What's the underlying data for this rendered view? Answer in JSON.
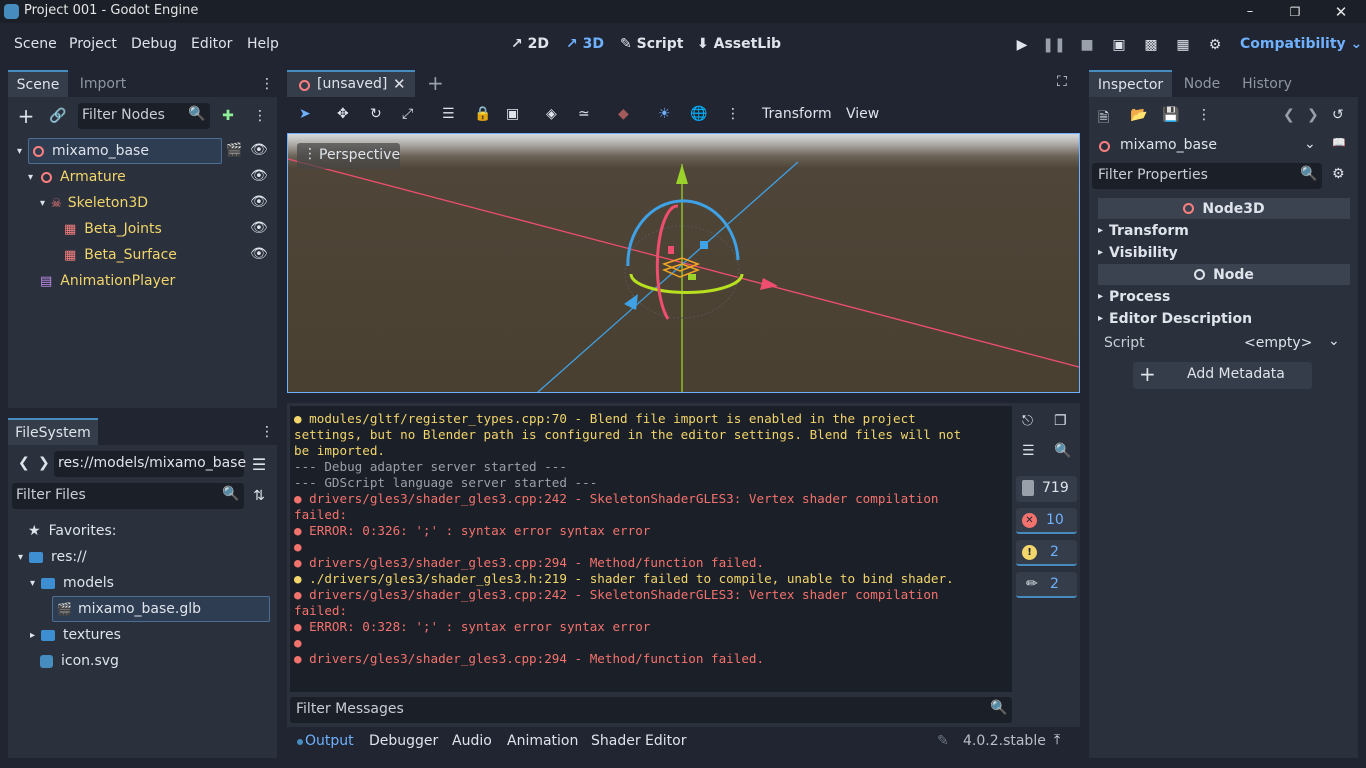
{
  "window": {
    "title": "Project 001 - Godot Engine"
  },
  "menus": [
    "Scene",
    "Project",
    "Debug",
    "Editor",
    "Help"
  ],
  "workspaces": {
    "2d": "2D",
    "3d": "3D",
    "script": "Script",
    "assetlib": "AssetLib"
  },
  "renderer": "Compatibility",
  "scene_dock": {
    "tab_scene": "Scene",
    "tab_import": "Import",
    "filter_placeholder": "Filter Nodes",
    "nodes": [
      {
        "label": "mixamo_base"
      },
      {
        "label": "Armature"
      },
      {
        "label": "Skeleton3D"
      },
      {
        "label": "Beta_Joints"
      },
      {
        "label": "Beta_Surface"
      },
      {
        "label": "AnimationPlayer"
      }
    ]
  },
  "filesystem": {
    "tab": "FileSystem",
    "path": "res://models/mixamo_base",
    "filter_placeholder": "Filter Files",
    "favorites": "Favorites:",
    "root": "res://",
    "models": "models",
    "file": "mixamo_base.glb",
    "textures": "textures",
    "icon": "icon.svg"
  },
  "viewport": {
    "tab": "[unsaved]",
    "transform": "Transform",
    "view": "View",
    "perspective": "Perspective"
  },
  "output": {
    "lines": [
      {
        "c": "y",
        "dot": true,
        "t": "modules/gltf/register_types.cpp:70 - Blend file import is enabled in the project"
      },
      {
        "c": "y",
        "dot": false,
        "t": "settings, but no Blender path is configured in the editor settings. Blend files will not"
      },
      {
        "c": "y",
        "dot": false,
        "t": "be imported."
      },
      {
        "c": "g",
        "dot": false,
        "t": "--- Debug adapter server started ---"
      },
      {
        "c": "g",
        "dot": false,
        "t": "--- GDScript language server started ---"
      },
      {
        "c": "r",
        "dot": true,
        "t": "drivers/gles3/shader_gles3.cpp:242 - SkeletonShaderGLES3: Vertex shader compilation"
      },
      {
        "c": "r",
        "dot": false,
        "t": "failed:"
      },
      {
        "c": "r",
        "dot": true,
        "t": "ERROR: 0:326: ';' : syntax error syntax error"
      },
      {
        "c": "r",
        "dot": true,
        "t": ""
      },
      {
        "c": "r",
        "dot": true,
        "t": "drivers/gles3/shader_gles3.cpp:294 - Method/function failed."
      },
      {
        "c": "y",
        "dot": true,
        "t": "./drivers/gles3/shader_gles3.h:219 - shader failed to compile, unable to bind shader."
      },
      {
        "c": "r",
        "dot": true,
        "t": "drivers/gles3/shader_gles3.cpp:242 - SkeletonShaderGLES3: Vertex shader compilation"
      },
      {
        "c": "r",
        "dot": false,
        "t": "failed:"
      },
      {
        "c": "r",
        "dot": true,
        "t": "ERROR: 0:328: ';' : syntax error syntax error"
      },
      {
        "c": "r",
        "dot": true,
        "t": ""
      },
      {
        "c": "r",
        "dot": true,
        "t": "drivers/gles3/shader_gles3.cpp:294 - Method/function failed."
      }
    ],
    "counts": {
      "all": "719",
      "errors": "10",
      "warnings": "2",
      "editor": "2"
    },
    "filter_placeholder": "Filter Messages"
  },
  "bottom_tabs": [
    "Output",
    "Debugger",
    "Audio",
    "Animation",
    "Shader Editor"
  ],
  "version": "4.0.2.stable",
  "inspector": {
    "tab_inspector": "Inspector",
    "tab_node": "Node",
    "tab_history": "History",
    "object": "mixamo_base",
    "filter_placeholder": "Filter Properties",
    "node3d": "Node3D",
    "transform": "Transform",
    "visibility": "Visibility",
    "node": "Node",
    "process": "Process",
    "editor_desc": "Editor Description",
    "script_label": "Script",
    "script_value": "<empty>",
    "add_metadata": "Add Metadata"
  },
  "colors": {
    "accent": "#478cbf",
    "node3d_icon": "#fc7f7f",
    "anim_icon": "#c38ef1",
    "folder": "#3d8fd1"
  }
}
